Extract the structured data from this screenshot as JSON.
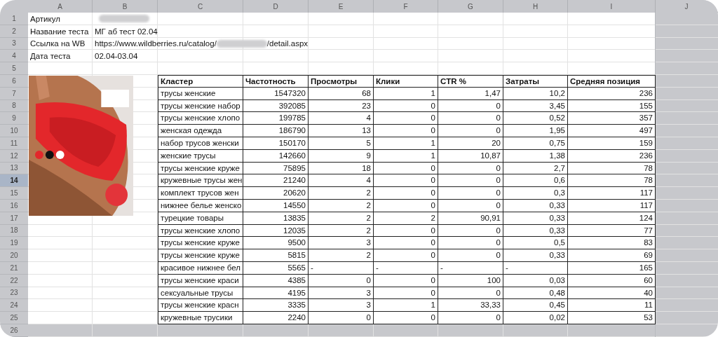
{
  "columns": [
    {
      "label": "A"
    },
    {
      "label": "B"
    },
    {
      "label": "C"
    },
    {
      "label": "D"
    },
    {
      "label": "E"
    },
    {
      "label": "F"
    },
    {
      "label": "G"
    },
    {
      "label": "H"
    },
    {
      "label": "I"
    },
    {
      "label": "J"
    }
  ],
  "rows": [
    {
      "label": "1",
      "selected": false
    },
    {
      "label": "2",
      "selected": false
    },
    {
      "label": "3",
      "selected": false
    },
    {
      "label": "4",
      "selected": false
    },
    {
      "label": "5",
      "selected": false
    },
    {
      "label": "6",
      "selected": false
    },
    {
      "label": "7",
      "selected": false
    },
    {
      "label": "8",
      "selected": false
    },
    {
      "label": "9",
      "selected": false
    },
    {
      "label": "10",
      "selected": false
    },
    {
      "label": "11",
      "selected": false
    },
    {
      "label": "12",
      "selected": false
    },
    {
      "label": "13",
      "selected": false
    },
    {
      "label": "14",
      "selected": true
    },
    {
      "label": "15",
      "selected": false
    },
    {
      "label": "16",
      "selected": false
    },
    {
      "label": "17",
      "selected": false
    },
    {
      "label": "18",
      "selected": false
    },
    {
      "label": "19",
      "selected": false
    },
    {
      "label": "20",
      "selected": false
    },
    {
      "label": "21",
      "selected": false
    },
    {
      "label": "22",
      "selected": false
    },
    {
      "label": "23",
      "selected": false
    },
    {
      "label": "24",
      "selected": false
    },
    {
      "label": "25",
      "selected": false
    },
    {
      "label": "26",
      "selected": false
    }
  ],
  "info": [
    {
      "label": "Артикул",
      "parts": [
        {
          "kind": "redacted"
        }
      ]
    },
    {
      "label": "Название теста",
      "parts": [
        {
          "kind": "text",
          "text": "МГ аб тест 02.04"
        }
      ]
    },
    {
      "label": "Ссылка на WB",
      "parts": [
        {
          "kind": "text",
          "text": "https://www.wildberries.ru/catalog/"
        },
        {
          "kind": "redacted"
        },
        {
          "kind": "text",
          "text": "/detail.aspx"
        }
      ]
    },
    {
      "label": "Дата теста",
      "parts": [
        {
          "kind": "text",
          "text": "02.04-03.04"
        }
      ]
    }
  ],
  "table": {
    "columns": [
      "Кластер",
      "Частотность",
      "Просмотры",
      "Клики",
      "CTR %",
      "Затраты",
      "Средняя позиция"
    ],
    "rows": [
      {
        "kind": "full",
        "cells": [
          "трусы женские",
          "1547320",
          "68",
          "1",
          "1,47",
          "10,2",
          "236"
        ]
      },
      {
        "kind": "full",
        "cells": [
          "трусы женские набор",
          "392085",
          "23",
          "0",
          "0",
          "3,45",
          "155"
        ]
      },
      {
        "kind": "full",
        "cells": [
          "трусы женские хлопо",
          "199785",
          "4",
          "0",
          "0",
          "0,52",
          "357"
        ]
      },
      {
        "kind": "full",
        "cells": [
          "женская одежда",
          "186790",
          "13",
          "0",
          "0",
          "1,95",
          "497"
        ]
      },
      {
        "kind": "full",
        "cells": [
          "набор трусов женски",
          "150170",
          "5",
          "1",
          "20",
          "0,75",
          "159"
        ]
      },
      {
        "kind": "full",
        "cells": [
          "женские трусы",
          "142660",
          "9",
          "1",
          "10,87",
          "1,38",
          "236"
        ]
      },
      {
        "kind": "full",
        "cells": [
          "трусы женские круже",
          "75895",
          "18",
          "0",
          "0",
          "2,7",
          "78"
        ]
      },
      {
        "kind": "full",
        "cells": [
          "кружевные трусы жен",
          "21240",
          "4",
          "0",
          "0",
          "0,6",
          "78"
        ]
      },
      {
        "kind": "full",
        "cells": [
          "комплект трусов жен",
          "20620",
          "2",
          "0",
          "0",
          "0,3",
          "117"
        ]
      },
      {
        "kind": "full",
        "cells": [
          "нижнее белье женско",
          "14550",
          "2",
          "0",
          "0",
          "0,33",
          "117"
        ]
      },
      {
        "kind": "full",
        "cells": [
          "турецкие товары",
          "13835",
          "2",
          "2",
          "90,91",
          "0,33",
          "124"
        ]
      },
      {
        "kind": "full",
        "cells": [
          "трусы женские хлопо",
          "12035",
          "2",
          "0",
          "0",
          "0,33",
          "77"
        ]
      },
      {
        "kind": "full",
        "cells": [
          "трусы женские круже",
          "9500",
          "3",
          "0",
          "0",
          "0,5",
          "83"
        ]
      },
      {
        "kind": "full",
        "cells": [
          "трусы женские круже",
          "5815",
          "2",
          "0",
          "0",
          "0,33",
          "69"
        ]
      },
      {
        "kind": "partial",
        "cells": [
          "красивое нижнее бел",
          "5565",
          "-",
          "-",
          "-",
          "-",
          "165"
        ]
      },
      {
        "kind": "full",
        "cells": [
          "трусы женские краси",
          "4385",
          "0",
          "0",
          "100",
          "0,03",
          "60"
        ]
      },
      {
        "kind": "full",
        "cells": [
          "сексуальные трусы",
          "4195",
          "3",
          "0",
          "0",
          "0,48",
          "40"
        ]
      },
      {
        "kind": "full",
        "cells": [
          "трусы женские красн",
          "3335",
          "3",
          "1",
          "33,33",
          "0,45",
          "11"
        ]
      },
      {
        "kind": "full",
        "cells": [
          "кружевные трусики",
          "2240",
          "0",
          "0",
          "0",
          "0,02",
          "53"
        ]
      }
    ]
  }
}
